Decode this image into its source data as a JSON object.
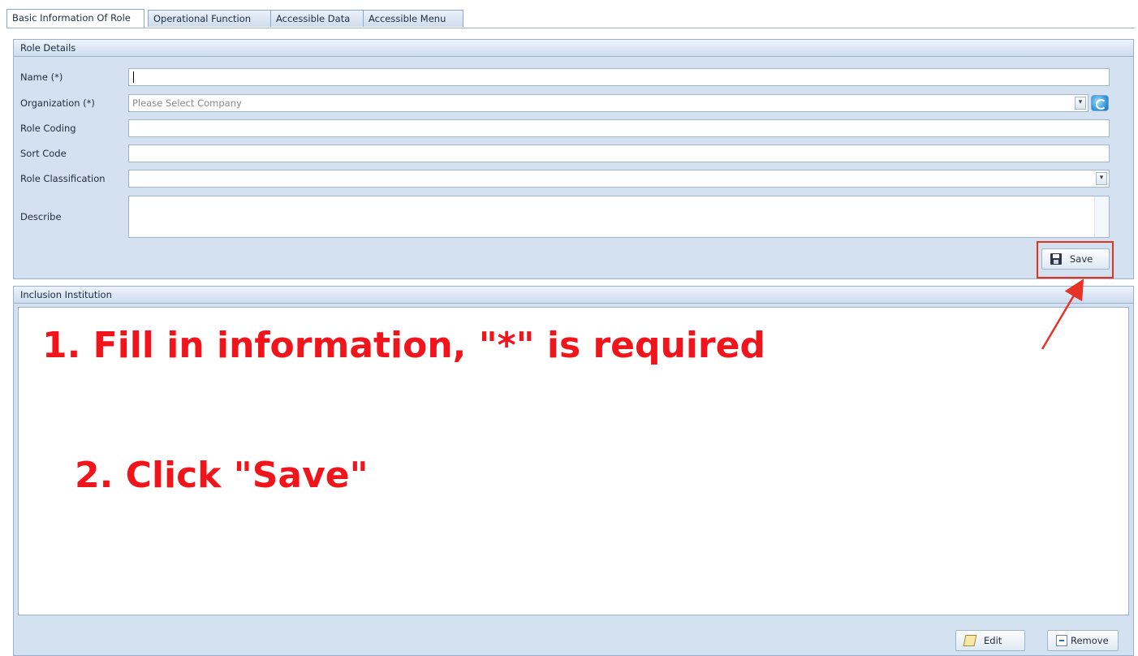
{
  "tabs": [
    {
      "label": "Basic Information Of Role",
      "active": true
    },
    {
      "label": "Operational Function",
      "active": false
    },
    {
      "label": "Accessible Data",
      "active": false
    },
    {
      "label": "Accessible Menu",
      "active": false
    }
  ],
  "role_details": {
    "title": "Role Details",
    "fields": {
      "name": {
        "label": "Name (*)",
        "value": ""
      },
      "organization": {
        "label": "Organization (*)",
        "placeholder": "Please Select Company"
      },
      "role_coding": {
        "label": "Role Coding",
        "value": ""
      },
      "sort_code": {
        "label": "Sort Code",
        "value": ""
      },
      "role_classification": {
        "label": "Role Classification",
        "value": ""
      },
      "describe": {
        "label": "Describe",
        "value": ""
      }
    },
    "save_label": "Save"
  },
  "inclusion": {
    "title": "Inclusion Institution",
    "edit_label": "Edit",
    "remove_label": "Remove"
  },
  "annotations": {
    "step1": "1. Fill in information, \"*\" is required",
    "step2": "2. Click \"Save\"",
    "color": "#f2141b"
  },
  "icons": {
    "dropdown": "chevron-down-icon",
    "refresh": "refresh-icon",
    "save": "save-icon",
    "edit": "edit-icon",
    "remove": "remove-icon"
  }
}
